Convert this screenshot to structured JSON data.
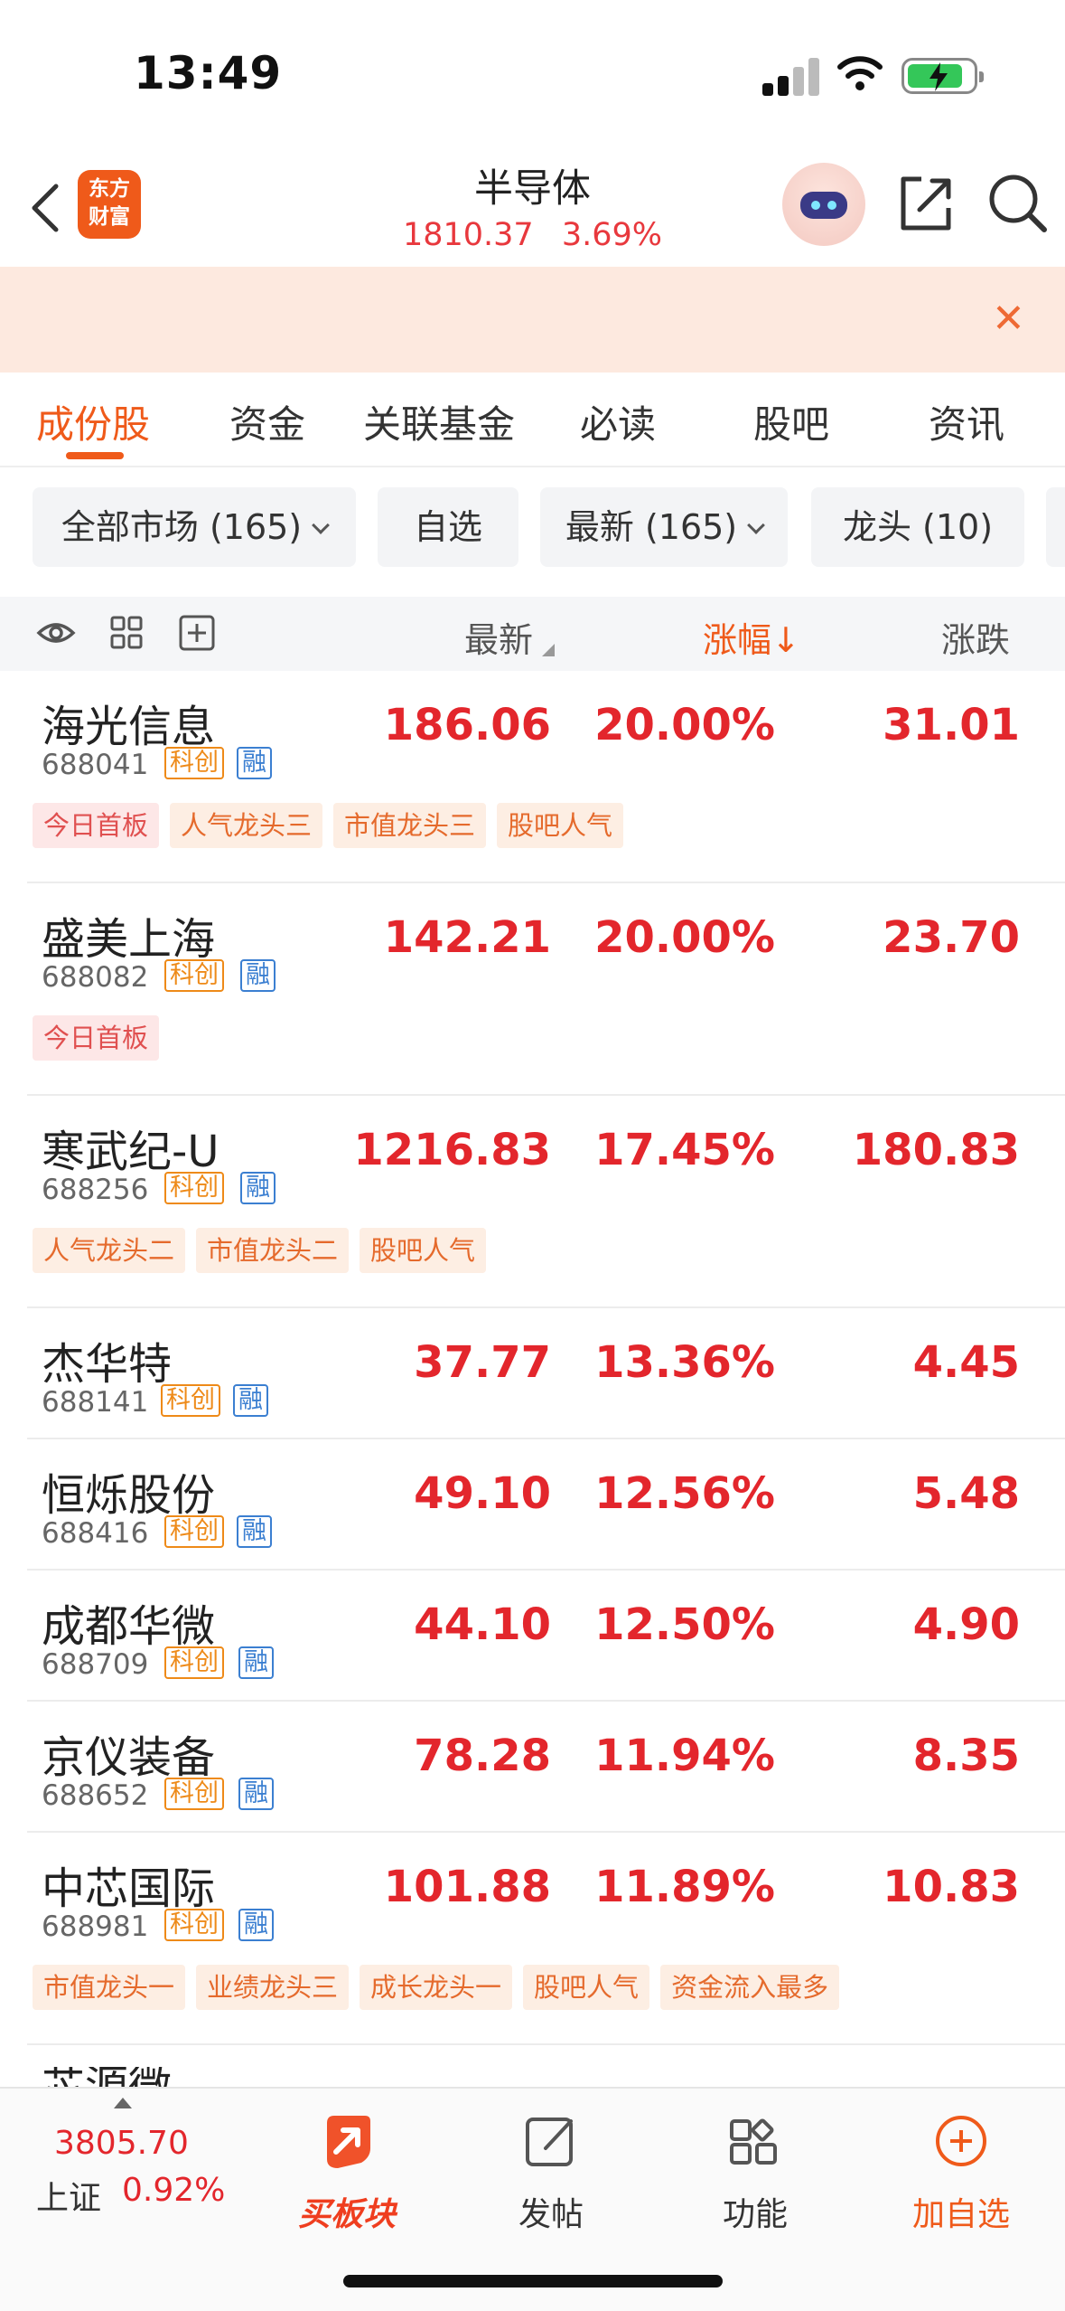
{
  "status": {
    "time": "13:49"
  },
  "header": {
    "logo_line1": "东方",
    "logo_line2": "财富",
    "title": "半导体",
    "index_value": "1810.37",
    "index_change": "3.69%"
  },
  "tabs": [
    "成份股",
    "资金",
    "关联基金",
    "必读",
    "股吧",
    "资讯"
  ],
  "filters": [
    "全部市场 (165)",
    "自选",
    "最新 (165)",
    "龙头 (10)"
  ],
  "columns": {
    "latest": "最新",
    "change_pct": "涨幅",
    "sort_arrow": "↓",
    "change_amt": "涨跌"
  },
  "badges": {
    "kc": "科创",
    "rong": "融"
  },
  "stocks": [
    {
      "name": "海光信息",
      "code": "688041",
      "latest": "186.06",
      "pct": "20.00%",
      "chg": "31.01",
      "tags": [
        "今日首板",
        "人气龙头三",
        "市值龙头三",
        "股吧人气"
      ]
    },
    {
      "name": "盛美上海",
      "code": "688082",
      "latest": "142.21",
      "pct": "20.00%",
      "chg": "23.70",
      "tags": [
        "今日首板"
      ]
    },
    {
      "name": "寒武纪-U",
      "code": "688256",
      "latest": "1216.83",
      "pct": "17.45%",
      "chg": "180.83",
      "tags": [
        "人气龙头二",
        "市值龙头二",
        "股吧人气"
      ]
    },
    {
      "name": "杰华特",
      "code": "688141",
      "latest": "37.77",
      "pct": "13.36%",
      "chg": "4.45",
      "tags": []
    },
    {
      "name": "恒烁股份",
      "code": "688416",
      "latest": "49.10",
      "pct": "12.56%",
      "chg": "5.48",
      "tags": []
    },
    {
      "name": "成都华微",
      "code": "688709",
      "latest": "44.10",
      "pct": "12.50%",
      "chg": "4.90",
      "tags": []
    },
    {
      "name": "京仪装备",
      "code": "688652",
      "latest": "78.28",
      "pct": "11.94%",
      "chg": "8.35",
      "tags": []
    },
    {
      "name": "中芯国际",
      "code": "688981",
      "latest": "101.88",
      "pct": "11.89%",
      "chg": "10.83",
      "tags": [
        "市值龙头一",
        "业绩龙头三",
        "成长龙头一",
        "股吧人气",
        "资金流入最多"
      ]
    }
  ],
  "bottom": {
    "index_value": "3805.70",
    "index_name": "上证",
    "index_pct": "0.92%",
    "buy_sector": "买板块",
    "post": "发帖",
    "functions": "功能",
    "add_watch": "加自选"
  },
  "colors": {
    "accent": "#ef5a1a",
    "up": "#e3262c",
    "banner": "#fde9df"
  }
}
